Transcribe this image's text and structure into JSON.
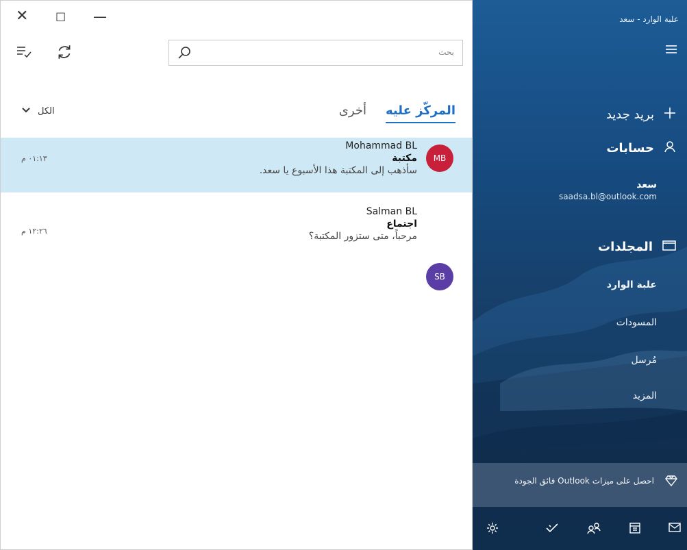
{
  "window": {
    "close_glyph": "✕",
    "maximize_glyph": "☐",
    "minimize_glyph": "—"
  },
  "toolbar": {
    "select_icon": "select-list-icon",
    "sync_icon": "sync-icon"
  },
  "search": {
    "placeholder": "بحث",
    "icon": "search-icon"
  },
  "tabs": [
    {
      "label": "المركّز عليه",
      "active": true
    },
    {
      "label": "أخرى",
      "active": false
    }
  ],
  "filter": {
    "label": "الكل",
    "icon": "chevron-down-icon"
  },
  "messages": [
    {
      "initials": "MB",
      "avatar_color": "#c8203a",
      "sender": "Mohammad BL",
      "subject": "مكتبة",
      "preview": "سأذهب إلى المكتبة هذا الأسبوع يا سعد.",
      "time": "٠١:١٣ م",
      "selected": true
    },
    {
      "initials": "SB",
      "avatar_color": "#5a3ea6",
      "sender": "Salman BL",
      "subject": "اجتماع",
      "preview": "مرحباً، متى ستزور المكتبة؟",
      "time": "١٢:٢٦ م",
      "selected": false
    }
  ],
  "nav": {
    "title": "علبة الوارد - سعد",
    "menu_icon": "hamburger-icon",
    "new_mail": "بريد جديد",
    "accounts_label": "حسابات",
    "account_name": "سعد",
    "account_email": "saadsa.bl@outlook.com",
    "folders_label": "المجلدات",
    "folders": [
      "علبة الوارد",
      "المسودات",
      "مُرسل",
      "المزيد"
    ],
    "promo": "احصل على ميزات Outlook فائق الجودة",
    "bottom_icons": [
      "mail-icon",
      "calendar-icon",
      "people-icon",
      "todo-icon",
      "settings-icon"
    ]
  },
  "colors": {
    "accent": "#1f6fc4",
    "selected_row": "#cfe8f5",
    "nav_bg": "#164b80"
  }
}
